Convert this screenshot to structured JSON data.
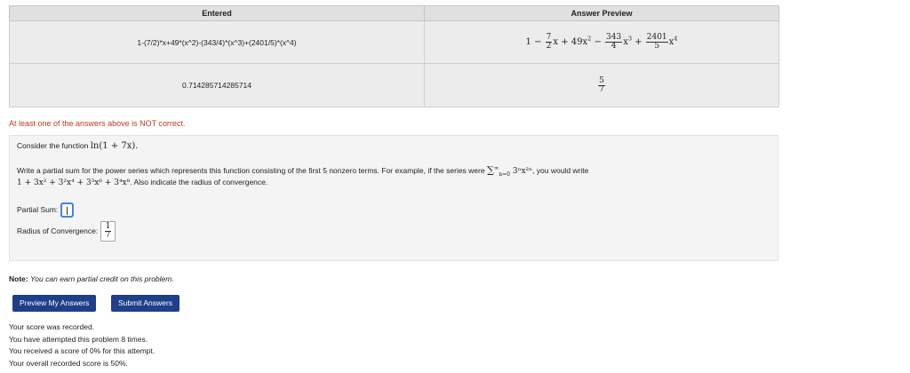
{
  "results_table": {
    "headers": {
      "entered": "Entered",
      "preview": "Answer Preview"
    },
    "rows": [
      {
        "entered": "1-(7/2)*x+49*(x^2)-(343/4)*(x^3)+(2401/5)*(x^4)",
        "preview": {
          "t1": "1 −",
          "f1": {
            "num": "7",
            "den": "2"
          },
          "t2": "x + 49x",
          "e2": "2",
          "t3": " −",
          "f2": {
            "num": "343",
            "den": "4"
          },
          "t4": "x",
          "e3": "3",
          "t5": " +",
          "f3": {
            "num": "2401",
            "den": "5"
          },
          "t6": "x",
          "e4": "4"
        }
      },
      {
        "entered": "0.714285714285714",
        "preview": {
          "num": "5",
          "den": "7"
        }
      }
    ]
  },
  "alert": "At least one of the answers above is NOT correct.",
  "problem": {
    "consider_prefix": "Consider the function ",
    "function": "ln(1 + 7x).",
    "write_text": "Write a partial sum for the power series which represents this function consisting of the first 5 nonzero terms. For example, if the series were",
    "sum_symbol": "∑",
    "sum_upper": "∞",
    "sum_lower": "n=0",
    "sum_term": "3ⁿx²ⁿ",
    "write_suffix": ", you would write",
    "example": "1 + 3x² + 3²x⁴ + 3³x⁶ + 3⁴x⁸",
    "example_suffix": ". Also indicate the radius of convergence.",
    "partial_sum_label": "Partial Sum:",
    "radius_label": "Radius of Convergence:",
    "radius_value": {
      "num": "1",
      "den": "7"
    }
  },
  "note": {
    "bold": "Note:",
    "text": "You can earn partial credit on this problem."
  },
  "buttons": {
    "preview": "Preview My Answers",
    "submit": "Submit Answers"
  },
  "status_lines": [
    "Your score was recorded.",
    "You have attempted this problem 8 times.",
    "You received a score of 0% for this attempt.",
    "Your overall recorded score is 50%."
  ]
}
